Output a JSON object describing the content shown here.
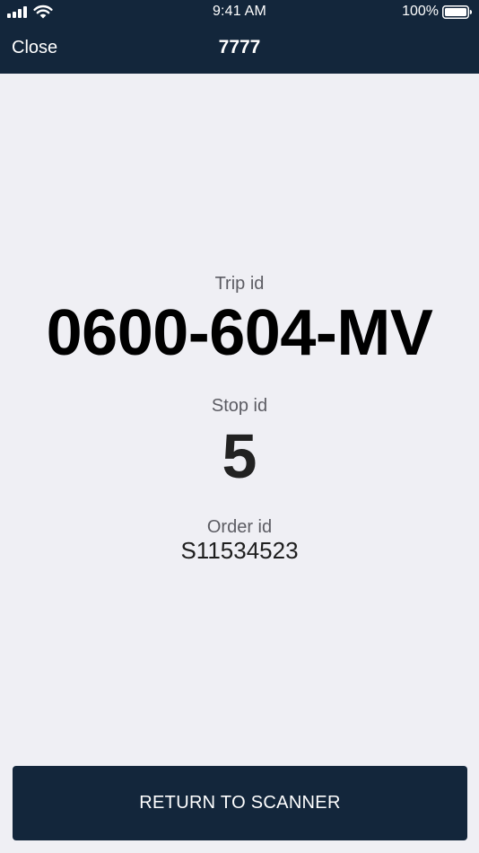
{
  "status_bar": {
    "time": "9:41 AM",
    "battery_percent": "100%",
    "battery_level": 1.0,
    "signal_bars": 4
  },
  "nav": {
    "close_label": "Close",
    "title": "7777"
  },
  "details": {
    "trip_label": "Trip id",
    "trip_value": "0600-604-MV",
    "stop_label": "Stop id",
    "stop_value": "5",
    "order_label": "Order id",
    "order_value": "S11534523"
  },
  "actions": {
    "return_label": "RETURN TO SCANNER"
  },
  "colors": {
    "header_bg": "#13263b",
    "page_bg": "#efeff4",
    "button_bg": "#13263b",
    "label_text": "#5c5c63"
  },
  "icons": [
    "cellular-signal-icon",
    "wifi-icon",
    "battery-icon"
  ]
}
